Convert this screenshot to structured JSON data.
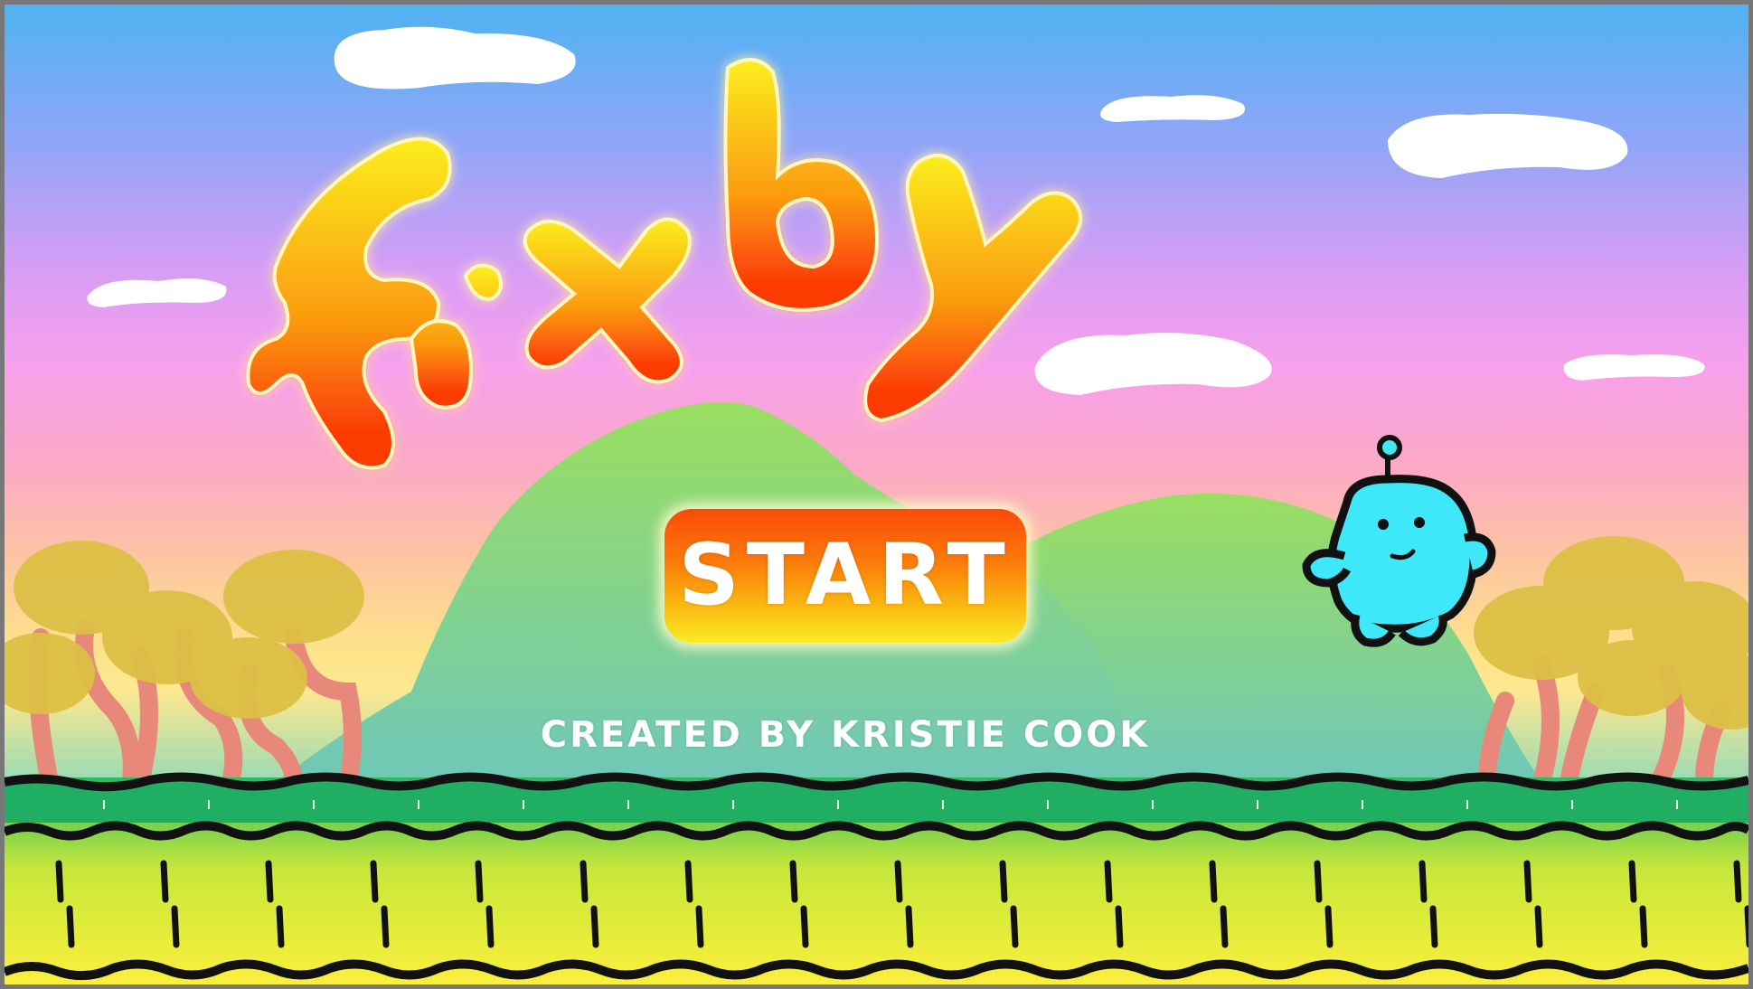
{
  "game": {
    "title": "fixby",
    "start_label": "START",
    "credit": "CREATED BY KRISTIE COOK"
  },
  "colors": {
    "sky_top": "#4fb2f2",
    "sky_mid": "#f7a0ec",
    "sky_horizon": "#fde38a",
    "hill": "#8fd86e",
    "tree_canopy": "#dcc045",
    "tree_trunk": "#e98a78",
    "grass_band": "#1fae62",
    "ground": "#f7ec3e",
    "logo_top": "#fbe920",
    "logo_bottom": "#fb3a05",
    "robot_body": "#3ee8f8",
    "outline": "#111111"
  },
  "icons": {
    "player": "robot-character-icon",
    "clouds": "cloud-icon",
    "trees": "tree-icon"
  }
}
